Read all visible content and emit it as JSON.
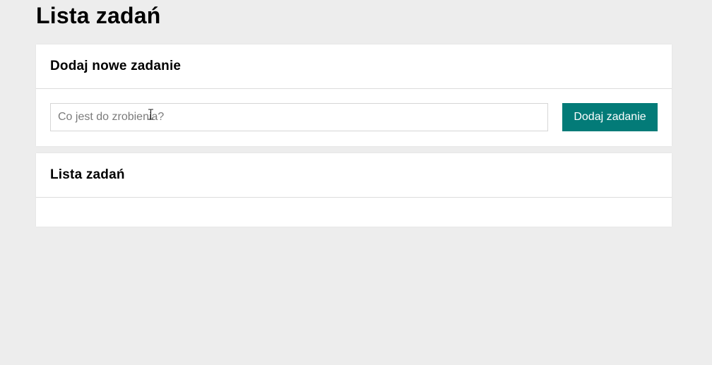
{
  "page": {
    "title": "Lista zadań"
  },
  "add_task": {
    "heading": "Dodaj nowe zadanie",
    "input_placeholder": "Co jest do zrobienia?",
    "input_value": "",
    "button_label": "Dodaj zadanie"
  },
  "task_list": {
    "heading": "Lista zadań",
    "items": []
  },
  "colors": {
    "background": "#ededed",
    "card": "#ffffff",
    "accent": "#037b78"
  },
  "icons": {
    "cursor": "text-cursor-icon"
  }
}
